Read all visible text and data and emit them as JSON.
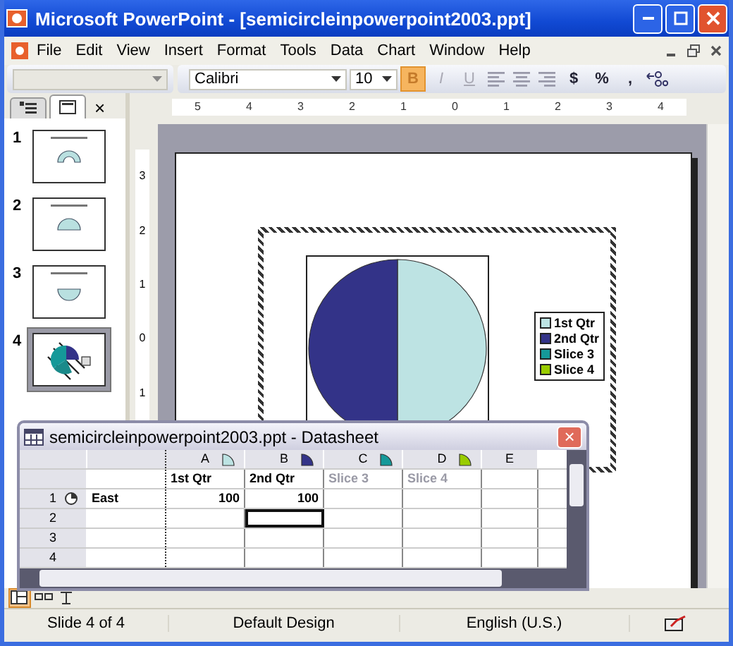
{
  "window": {
    "title": "Microsoft PowerPoint - [semicircleinpowerpoint2003.ppt]"
  },
  "menu": [
    "File",
    "Edit",
    "View",
    "Insert",
    "Format",
    "Tools",
    "Data",
    "Chart",
    "Window",
    "Help"
  ],
  "toolbar": {
    "font": "Calibri",
    "size": "10",
    "buttons": [
      {
        "label": "B",
        "kind": "bold",
        "selected": true,
        "disabled": false
      },
      {
        "label": "I",
        "kind": "italic",
        "selected": false,
        "disabled": true
      },
      {
        "label": "U",
        "kind": "underline",
        "selected": false,
        "disabled": true
      }
    ],
    "symbols": [
      "$",
      "%",
      ","
    ]
  },
  "slides_pane": {
    "tabs": [
      {
        "kind": "outline",
        "selected": false
      },
      {
        "kind": "slides",
        "selected": true
      }
    ],
    "close": "×",
    "slides": [
      {
        "number": "1",
        "kind": "arch",
        "selected": false
      },
      {
        "number": "2",
        "kind": "dome",
        "selected": false
      },
      {
        "number": "3",
        "kind": "bowl",
        "selected": false
      },
      {
        "number": "4",
        "kind": "pie",
        "selected": true
      }
    ]
  },
  "ruler": {
    "horizontal": [
      "5",
      "4",
      "3",
      "2",
      "1",
      "0",
      "1",
      "2",
      "3",
      "4"
    ],
    "vertical": [
      "3",
      "2",
      "1",
      "0",
      "1"
    ]
  },
  "chart": {
    "legend": [
      {
        "label": "1st Qtr",
        "color": "#bde3e3"
      },
      {
        "label": "2nd Qtr",
        "color": "#333388"
      },
      {
        "label": "Slice 3",
        "color": "#159999"
      },
      {
        "label": "Slice 4",
        "color": "#99cc00"
      }
    ]
  },
  "datasheet": {
    "title": "semicircleinpowerpoint2003.ppt - Datasheet",
    "close": "×",
    "columns": [
      {
        "letter": "A",
        "series": "1st Qtr",
        "color": "#bde3e3",
        "included": true
      },
      {
        "letter": "B",
        "series": "2nd Qtr",
        "color": "#333388",
        "included": true
      },
      {
        "letter": "C",
        "series": "Slice 3",
        "color": "#159999",
        "included": false
      },
      {
        "letter": "D",
        "series": "Slice 4",
        "color": "#99cc00",
        "included": false
      },
      {
        "letter": "E"
      }
    ],
    "rows": [
      {
        "number": "1",
        "kind": "series",
        "label": "East",
        "cells": [
          {
            "text": "100",
            "selected": false
          },
          {
            "text": "100",
            "selected": false
          },
          {
            "selected": false
          },
          {
            "selected": false
          },
          {
            "selected": false
          }
        ]
      },
      {
        "number": "2",
        "kind": "empty",
        "cells": [
          {
            "selected": false
          },
          {
            "selected": true
          },
          {
            "selected": false
          },
          {
            "selected": false
          },
          {
            "selected": false
          }
        ]
      },
      {
        "number": "3",
        "kind": "empty",
        "cells": [
          {
            "selected": false
          },
          {
            "selected": false
          },
          {
            "selected": false
          },
          {
            "selected": false
          },
          {
            "selected": false
          }
        ]
      },
      {
        "number": "4",
        "kind": "empty",
        "cells": [
          {
            "selected": false
          },
          {
            "selected": false
          },
          {
            "selected": false
          },
          {
            "selected": false
          },
          {
            "selected": false
          }
        ]
      }
    ]
  },
  "status_bar": [
    "Slide 4 of 4",
    "Default Design",
    "English (U.S.)"
  ]
}
